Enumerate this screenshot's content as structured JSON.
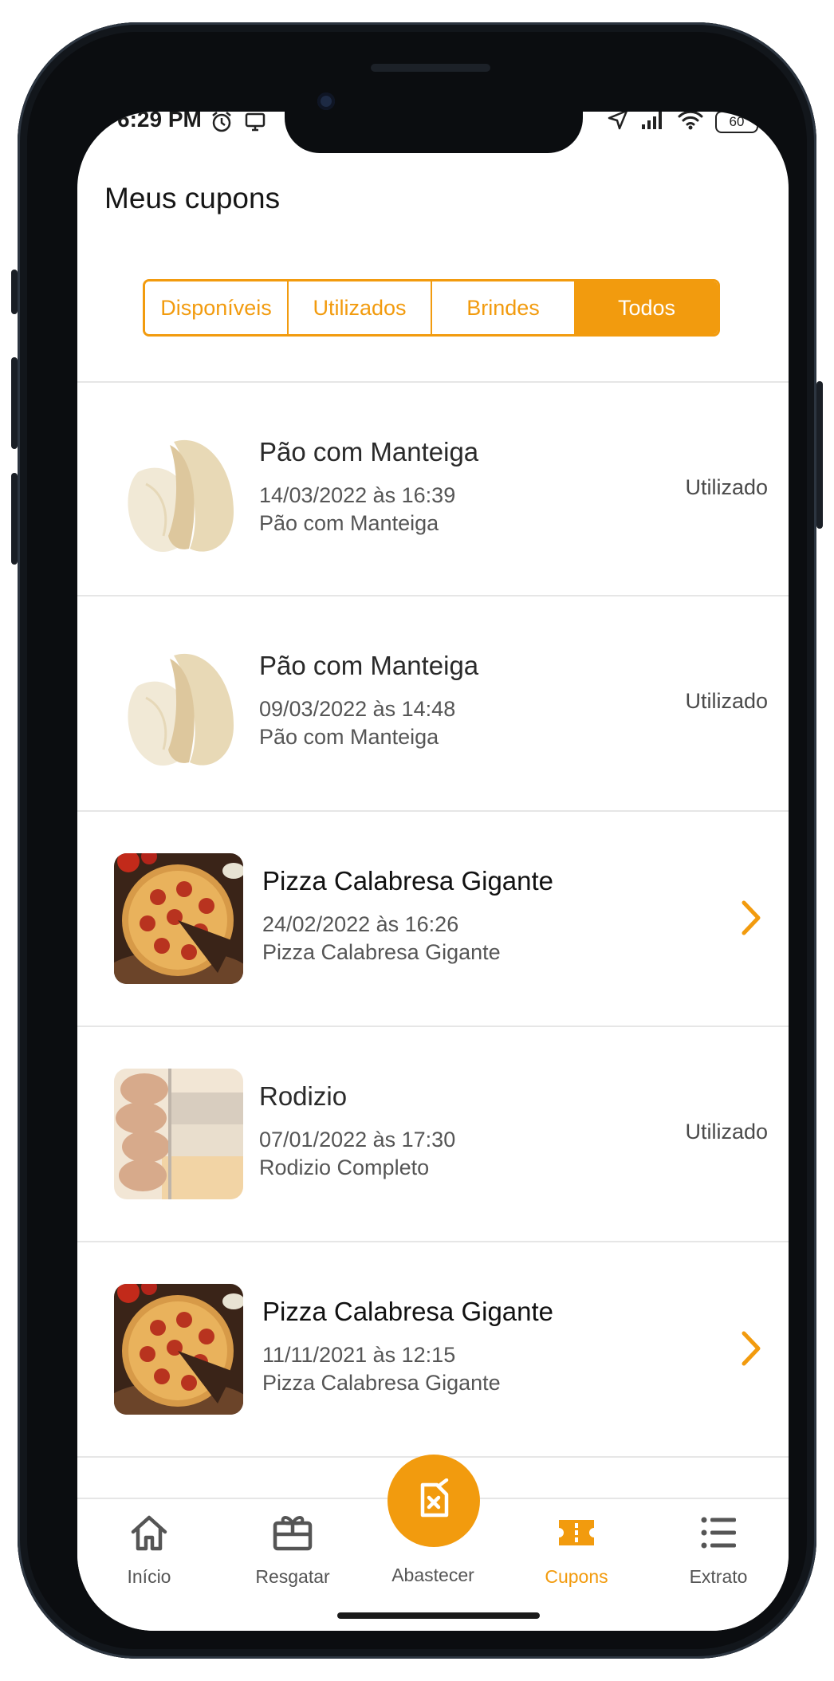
{
  "status_bar": {
    "time": "6:29 PM",
    "battery": "60"
  },
  "header": {
    "title": "Meus cupons"
  },
  "tabs": [
    {
      "label": "Disponíveis",
      "active": false
    },
    {
      "label": "Utilizados",
      "active": false
    },
    {
      "label": "Brindes",
      "active": false
    },
    {
      "label": "Todos",
      "active": true
    }
  ],
  "coupons": [
    {
      "title": "Pão com Manteiga",
      "date": "14/03/2022 às 16:39",
      "description": "Pão com Manteiga",
      "status": "Utilizado",
      "image": "bread-image"
    },
    {
      "title": "Pão com Manteiga",
      "date": "09/03/2022 às 14:48",
      "description": "Pão com Manteiga",
      "status": "Utilizado",
      "image": "bread-image"
    },
    {
      "title": "Pizza Calabresa Gigante",
      "date": "24/02/2022 às 16:26",
      "description": "Pizza Calabresa Gigante",
      "status": "",
      "image": "pizza-image"
    },
    {
      "title": "Rodizio",
      "date": "07/01/2022 às 17:30",
      "description": "Rodizio Completo",
      "status": "Utilizado",
      "image": "rodizio-image"
    },
    {
      "title": "Pizza Calabresa Gigante",
      "date": "11/11/2021 às 12:15",
      "description": "Pizza Calabresa Gigante",
      "status": "",
      "image": "pizza-image"
    }
  ],
  "nav": {
    "inicio": "Início",
    "resgatar": "Resgatar",
    "abastecer": "Abastecer",
    "cupons": "Cupons",
    "extrato": "Extrato"
  },
  "colors": {
    "accent": "#f29b0e"
  }
}
